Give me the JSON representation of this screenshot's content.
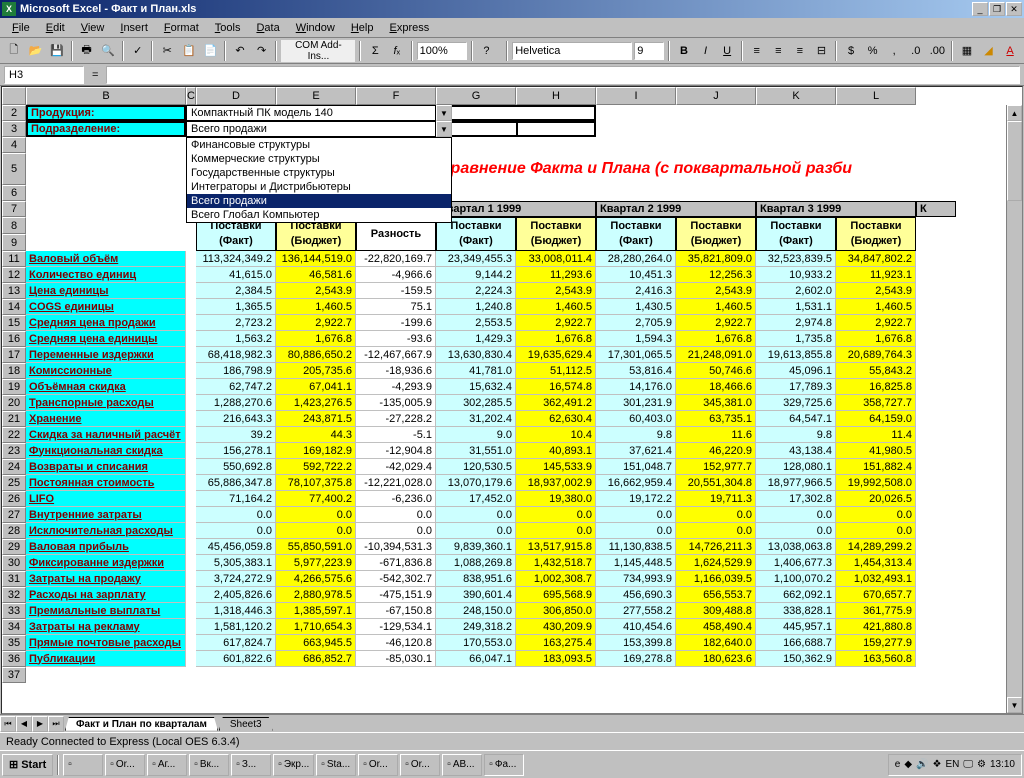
{
  "titlebar": {
    "app": "Microsoft Excel",
    "file": "Факт и План.xls"
  },
  "menu": [
    "File",
    "Edit",
    "View",
    "Insert",
    "Format",
    "Tools",
    "Data",
    "Window",
    "Help",
    "Express"
  ],
  "toolbar": {
    "zoom": "100%",
    "addins_label": "COM Add-Ins...",
    "font": "Helvetica",
    "fontsize": "9"
  },
  "namebox": "H3",
  "labels": {
    "product": "Продукция:",
    "product_value": "Компактный ПК модель 140",
    "division": "Подразделение:",
    "division_value": "Всего продажи"
  },
  "dropdown_options": [
    "Финансовые структуры",
    "Коммерческие структуры",
    "Государственные структуры",
    "Интеграторы и Дистрибьютеры",
    "Всего продажи",
    "Всего Глобал Компьютер"
  ],
  "dropdown_selected_index": 4,
  "title_red": "Сравнение Факта и Плана (с поквартальной разби",
  "quarters": [
    "Квартал 1 1999",
    "Квартал 2 1999",
    "Квартал 3 1999",
    "К"
  ],
  "sub_headers": {
    "fact": "Поставки (Факт)",
    "budget": "Поставки (Бюджет)",
    "diff": "Разность"
  },
  "col_letters": [
    "B",
    "C",
    "D",
    "E",
    "F",
    "G",
    "H",
    "I",
    "J",
    "K",
    "L"
  ],
  "row_numbers": [
    2,
    3,
    4,
    5,
    6,
    7,
    8,
    9,
    11,
    12,
    13,
    14,
    15,
    16,
    17,
    18,
    19,
    20,
    21,
    22,
    23,
    24,
    25,
    26,
    27,
    28,
    29,
    30,
    31,
    32,
    33,
    34,
    35,
    36,
    37
  ],
  "rows": [
    {
      "n": 11,
      "label": "Валовый объём",
      "v": [
        "113,324,349.2",
        "136,144,519.0",
        "-22,820,169.7",
        "23,349,455.3",
        "33,008,011.4",
        "28,280,264.0",
        "35,821,809.0",
        "32,523,839.5",
        "34,847,802.2"
      ]
    },
    {
      "n": 12,
      "label": "Количество единиц",
      "v": [
        "41,615.0",
        "46,581.6",
        "-4,966.6",
        "9,144.2",
        "11,293.6",
        "10,451.3",
        "12,256.3",
        "10,933.2",
        "11,923.1"
      ]
    },
    {
      "n": 13,
      "label": "Цена единицы",
      "v": [
        "2,384.5",
        "2,543.9",
        "-159.5",
        "2,224.3",
        "2,543.9",
        "2,416.3",
        "2,543.9",
        "2,602.0",
        "2,543.9"
      ]
    },
    {
      "n": 14,
      "label": "COGS единицы",
      "v": [
        "1,365.5",
        "1,460.5",
        "75.1",
        "1,240.8",
        "1,460.5",
        "1,430.5",
        "1,460.5",
        "1,531.1",
        "1,460.5"
      ]
    },
    {
      "n": 15,
      "label": "Средняя цена продажи",
      "v": [
        "2,723.2",
        "2,922.7",
        "-199.6",
        "2,553.5",
        "2,922.7",
        "2,705.9",
        "2,922.7",
        "2,974.8",
        "2,922.7"
      ]
    },
    {
      "n": 16,
      "label": "Средняя цена единицы",
      "v": [
        "1,563.2",
        "1,676.8",
        "-93.6",
        "1,429.3",
        "1,676.8",
        "1,594.3",
        "1,676.8",
        "1,735.8",
        "1,676.8"
      ]
    },
    {
      "n": 17,
      "label": "Переменные издержки",
      "v": [
        "68,418,982.3",
        "80,886,650.2",
        "-12,467,667.9",
        "13,630,830.4",
        "19,635,629.4",
        "17,301,065.5",
        "21,248,091.0",
        "19,613,855.8",
        "20,689,764.3"
      ]
    },
    {
      "n": 18,
      "label": "Комиссионные",
      "v": [
        "186,798.9",
        "205,735.6",
        "-18,936.6",
        "41,781.0",
        "51,112.5",
        "53,816.4",
        "50,746.6",
        "45,096.1",
        "55,843.2"
      ]
    },
    {
      "n": 19,
      "label": "Объёмная скидка",
      "v": [
        "62,747.2",
        "67,041.1",
        "-4,293.9",
        "15,632.4",
        "16,574.8",
        "14,176.0",
        "18,466.6",
        "17,789.3",
        "16,825.8"
      ]
    },
    {
      "n": 20,
      "label": "Транспорные расходы",
      "v": [
        "1,288,270.6",
        "1,423,276.5",
        "-135,005.9",
        "302,285.5",
        "362,491.2",
        "301,231.9",
        "345,381.0",
        "329,725.6",
        "358,727.7"
      ]
    },
    {
      "n": 21,
      "label": "Хранение",
      "v": [
        "216,643.3",
        "243,871.5",
        "-27,228.2",
        "31,202.4",
        "62,630.4",
        "60,403.0",
        "63,735.1",
        "64,547.1",
        "64,159.0"
      ]
    },
    {
      "n": 22,
      "label": "Скидка за наличный расчёт",
      "v": [
        "39.2",
        "44.3",
        "-5.1",
        "9.0",
        "10.4",
        "9.8",
        "11.6",
        "9.8",
        "11.4"
      ]
    },
    {
      "n": 23,
      "label": "Функциональная скидка",
      "v": [
        "156,278.1",
        "169,182.9",
        "-12,904.8",
        "31,551.0",
        "40,893.1",
        "37,621.4",
        "46,220.9",
        "43,138.4",
        "41,980.5"
      ]
    },
    {
      "n": 24,
      "label": "Возвраты и списания",
      "v": [
        "550,692.8",
        "592,722.2",
        "-42,029.4",
        "120,530.5",
        "145,533.9",
        "151,048.7",
        "152,977.7",
        "128,080.1",
        "151,882.4"
      ]
    },
    {
      "n": 25,
      "label": "Постоянная стоимость",
      "v": [
        "65,886,347.8",
        "78,107,375.8",
        "-12,221,028.0",
        "13,070,179.6",
        "18,937,002.9",
        "16,662,959.4",
        "20,551,304.8",
        "18,977,966.5",
        "19,992,508.0"
      ]
    },
    {
      "n": 26,
      "label": "LIFO",
      "v": [
        "71,164.2",
        "77,400.2",
        "-6,236.0",
        "17,452.0",
        "19,380.0",
        "19,172.2",
        "19,711.3",
        "17,302.8",
        "20,026.5"
      ]
    },
    {
      "n": 27,
      "label": "Внутренние затраты",
      "v": [
        "0.0",
        "0.0",
        "0.0",
        "0.0",
        "0.0",
        "0.0",
        "0.0",
        "0.0",
        "0.0"
      ]
    },
    {
      "n": 28,
      "label": "Исключительная расходы",
      "v": [
        "0.0",
        "0.0",
        "0.0",
        "0.0",
        "0.0",
        "0.0",
        "0.0",
        "0.0",
        "0.0"
      ]
    },
    {
      "n": 29,
      "label": "Валовая прибыль",
      "v": [
        "45,456,059.8",
        "55,850,591.0",
        "-10,394,531.3",
        "9,839,360.1",
        "13,517,915.8",
        "11,130,838.5",
        "14,726,211.3",
        "13,038,063.8",
        "14,289,299.2"
      ]
    },
    {
      "n": 30,
      "label": "Фиксированне издержки",
      "v": [
        "5,305,383.1",
        "5,977,223.9",
        "-671,836.8",
        "1,088,269.8",
        "1,432,518.7",
        "1,145,448.5",
        "1,624,529.9",
        "1,406,677.3",
        "1,454,313.4"
      ]
    },
    {
      "n": 31,
      "label": "Затраты на продажу",
      "v": [
        "3,724,272.9",
        "4,266,575.6",
        "-542,302.7",
        "838,951.6",
        "1,002,308.7",
        "734,993.9",
        "1,166,039.5",
        "1,100,070.2",
        "1,032,493.1"
      ]
    },
    {
      "n": 32,
      "label": "Расходы на зарплату",
      "v": [
        "2,405,826.6",
        "2,880,978.5",
        "-475,151.9",
        "390,601.4",
        "695,568.9",
        "456,690.3",
        "656,553.7",
        "662,092.1",
        "670,657.7"
      ]
    },
    {
      "n": 33,
      "label": "Премиальные выплаты",
      "v": [
        "1,318,446.3",
        "1,385,597.1",
        "-67,150.8",
        "248,150.0",
        "306,850.0",
        "277,558.2",
        "309,488.8",
        "338,828.1",
        "361,775.9"
      ]
    },
    {
      "n": 34,
      "label": "Затраты на рекламу",
      "v": [
        "1,581,120.2",
        "1,710,654.3",
        "-129,534.1",
        "249,318.2",
        "430,209.9",
        "410,454.6",
        "458,490.4",
        "445,957.1",
        "421,880.8"
      ]
    },
    {
      "n": 35,
      "label": "Прямые почтовые расходы",
      "v": [
        "617,824.7",
        "663,945.5",
        "-46,120.8",
        "170,553.0",
        "163,275.4",
        "153,399.8",
        "182,640.0",
        "166,688.7",
        "159,277.9"
      ]
    },
    {
      "n": 36,
      "label": "Публикации",
      "v": [
        "601,822.6",
        "686,852.7",
        "-85,030.1",
        "66,047.1",
        "183,093.5",
        "169,278.8",
        "180,623.6",
        "150,362.9",
        "163,560.8"
      ]
    }
  ],
  "sheettabs": {
    "active": "Факт и План по кварталам",
    "inactive": "Sheet3"
  },
  "statusbar": "Ready  Connected to Express  (Local OES 6.3.4)",
  "taskbar": {
    "start": "Start",
    "items": [
      "",
      "Or...",
      "Аг...",
      "Вк...",
      "З...",
      "Экр...",
      "Sta...",
      "Or...",
      "Or...",
      "AB...",
      "Фа..."
    ],
    "tray_labels": [
      "EN"
    ],
    "clock": "13:10"
  }
}
